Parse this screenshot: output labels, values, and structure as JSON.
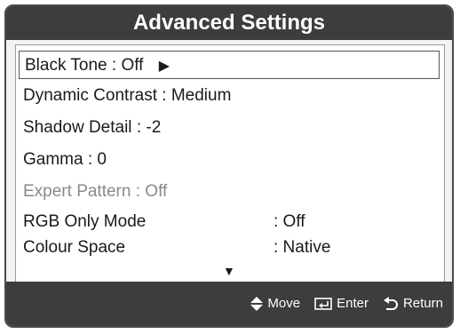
{
  "title": "Advanced Settings",
  "menu": {
    "items": [
      {
        "label": "Black Tone",
        "value": ": Off"
      },
      {
        "label": "Dynamic Contrast",
        "value": ": Medium"
      },
      {
        "label": "Shadow Detail",
        "value": ": -2"
      },
      {
        "label": "Gamma",
        "value": ": 0"
      },
      {
        "label": "Expert Pattern",
        "value": ": Off",
        "disabled": true
      },
      {
        "label": "RGB Only Mode",
        "value": ": Off"
      },
      {
        "label": "Colour Space",
        "value": ": Native"
      }
    ],
    "selected_index": 0
  },
  "footer": {
    "move": "Move",
    "enter": "Enter",
    "return": "Return"
  }
}
